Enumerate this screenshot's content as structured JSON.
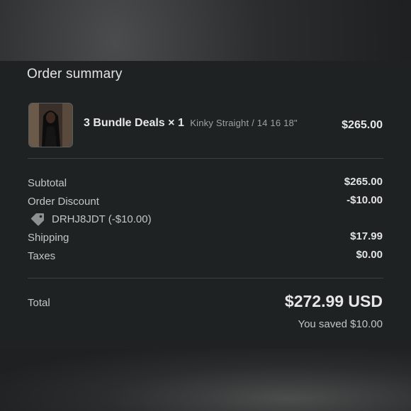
{
  "summary": {
    "title": "Order summary"
  },
  "item": {
    "name": "3 Bundle Deals × 1",
    "variant": "Kinky Straight / 14 16 18\"",
    "price": "$265.00"
  },
  "rows": {
    "subtotal_label": "Subtotal",
    "subtotal_value": "$265.00",
    "discount_label": "Order Discount",
    "discount_value": "-$10.00",
    "discount_code": "DRHJ8JDT (-$10.00)",
    "shipping_label": "Shipping",
    "shipping_value": "$17.99",
    "taxes_label": "Taxes",
    "taxes_value": "$0.00"
  },
  "total": {
    "label": "Total",
    "value": "$272.99 USD",
    "saved": "You saved $10.00"
  },
  "icons": {
    "discount": "tag-icon",
    "product": "product-thumbnail"
  },
  "colors": {
    "panel_bg": "#1e2223",
    "text": "#e2e4e4",
    "muted": "#9ea2a2"
  }
}
